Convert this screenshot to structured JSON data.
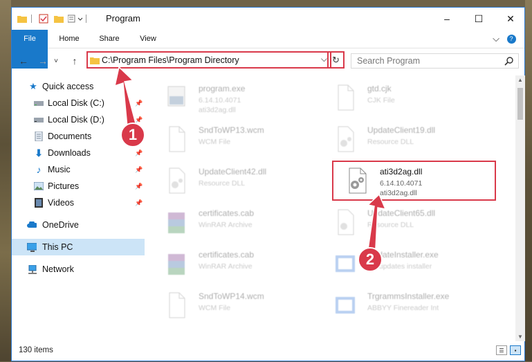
{
  "window": {
    "title": "Program",
    "minimize": "–",
    "maximize": "☐",
    "close": "✕"
  },
  "ribbon": {
    "tabs": [
      "File",
      "Home",
      "Share",
      "View"
    ],
    "help": "?"
  },
  "nav": {
    "back": "←",
    "forward": "→",
    "dropdown": "˅",
    "up": "↑"
  },
  "address": {
    "path": "C:\\Program Files\\Program Directory",
    "dropdown": "⌵",
    "refresh": "↻"
  },
  "search": {
    "placeholder": "Search Program",
    "icon": "search-icon"
  },
  "sidebar": {
    "items": [
      {
        "label": "Quick access",
        "icon": "star-icon",
        "pinned": false
      },
      {
        "label": "Local Disk (C:)",
        "icon": "drive-icon",
        "pinned": true
      },
      {
        "label": "Local Disk (D:)",
        "icon": "drive-icon",
        "pinned": true
      },
      {
        "label": "Documents",
        "icon": "documents-icon",
        "pinned": true
      },
      {
        "label": "Downloads",
        "icon": "download-icon",
        "pinned": true
      },
      {
        "label": "Music",
        "icon": "music-icon",
        "pinned": true
      },
      {
        "label": "Pictures",
        "icon": "pictures-icon",
        "pinned": true
      },
      {
        "label": "Videos",
        "icon": "videos-icon",
        "pinned": true
      },
      {
        "label": "OneDrive",
        "icon": "cloud-icon",
        "pinned": false
      },
      {
        "label": "This PC",
        "icon": "computer-icon",
        "pinned": false
      },
      {
        "label": "Network",
        "icon": "network-icon",
        "pinned": false
      }
    ],
    "pin_glyph": "📌"
  },
  "files": [
    {
      "name": "program.exe",
      "line2": "6.14.10.4071",
      "line3": "ati3d2ag.dll",
      "icon": "exe-icon"
    },
    {
      "name": "gtd.cjk",
      "line2": "CJK File",
      "line3": "",
      "icon": "blank-file-icon"
    },
    {
      "name": "SndToWP13.wcm",
      "line2": "WCM File",
      "line3": "",
      "icon": "blank-file-icon"
    },
    {
      "name": "UpdateClient19.dll",
      "line2": "Resource DLL",
      "line3": "",
      "icon": "dll-icon"
    },
    {
      "name": "UpdateClient42.dll",
      "line2": "Resource DLL",
      "line3": "",
      "icon": "dll-icon"
    },
    {
      "name": "ati3d2ag.dll",
      "line2": "6.14.10.4071",
      "line3": "ati3d2ag.dll",
      "icon": "dll-icon"
    },
    {
      "name": "certificates.cab",
      "line2": "WinRAR Archive",
      "line3": "",
      "icon": "winrar-icon"
    },
    {
      "name": "UpdateClient65.dll",
      "line2": "Resource DLL",
      "line3": "",
      "icon": "dll-icon"
    },
    {
      "name": "certificates.cab",
      "line2": "WinRAR Archive",
      "line3": "",
      "icon": "winrar-icon"
    },
    {
      "name": "UpdateInstaller.exe",
      "line2": "BY updates installer",
      "line3": "",
      "icon": "installer-icon"
    },
    {
      "name": "SndToWP14.wcm",
      "line2": "WCM File",
      "line3": "",
      "icon": "blank-file-icon"
    },
    {
      "name": "TrgrammsInstaller.exe",
      "line2": "ABBYY Finereader Int",
      "line3": "",
      "icon": "installer-icon"
    }
  ],
  "status": {
    "count": "130 items"
  },
  "callouts": {
    "one": "1",
    "two": "2"
  },
  "colors": {
    "accent": "#1979ca",
    "highlight": "#d9394a",
    "selected": "#cce4f7"
  }
}
